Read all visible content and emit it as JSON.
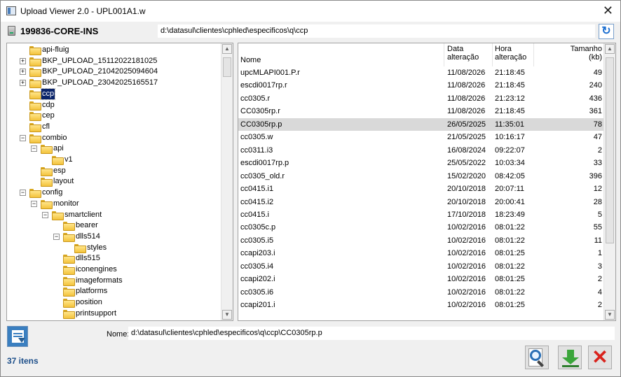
{
  "window": {
    "title": "Upload Viewer 2.0 - UPL001A1.w",
    "close_glyph": "✕"
  },
  "toolbar": {
    "host": "199836-CORE-INS",
    "path": "d:\\datasul\\clientes\\cphled\\especificos\\q\\ccp",
    "refresh_glyph": "↻"
  },
  "tree": {
    "items": [
      {
        "label": "api-fluig",
        "level": 1,
        "expander": "",
        "selected": false
      },
      {
        "label": "BKP_UPLOAD_15112022181025",
        "level": 1,
        "expander": "+",
        "selected": false
      },
      {
        "label": "BKP_UPLOAD_21042025094604",
        "level": 1,
        "expander": "+",
        "selected": false
      },
      {
        "label": "BKP_UPLOAD_23042025165517",
        "level": 1,
        "expander": "+",
        "selected": false
      },
      {
        "label": "ccp",
        "level": 1,
        "expander": "",
        "selected": true
      },
      {
        "label": "cdp",
        "level": 1,
        "expander": "",
        "selected": false
      },
      {
        "label": "cep",
        "level": 1,
        "expander": "",
        "selected": false
      },
      {
        "label": "cfl",
        "level": 1,
        "expander": "",
        "selected": false
      },
      {
        "label": "combio",
        "level": 1,
        "expander": "-",
        "selected": false
      },
      {
        "label": "api",
        "level": 2,
        "expander": "-",
        "selected": false
      },
      {
        "label": "v1",
        "level": 3,
        "expander": "",
        "selected": false
      },
      {
        "label": "esp",
        "level": 2,
        "expander": "",
        "selected": false
      },
      {
        "label": "layout",
        "level": 2,
        "expander": "",
        "selected": false
      },
      {
        "label": "config",
        "level": 1,
        "expander": "-",
        "selected": false
      },
      {
        "label": "monitor",
        "level": 2,
        "expander": "-",
        "selected": false
      },
      {
        "label": "smartclient",
        "level": 3,
        "expander": "-",
        "selected": false
      },
      {
        "label": "bearer",
        "level": 4,
        "expander": "",
        "selected": false
      },
      {
        "label": "dlls514",
        "level": 4,
        "expander": "-",
        "selected": false
      },
      {
        "label": "styles",
        "level": 5,
        "expander": "",
        "selected": false
      },
      {
        "label": "dlls515",
        "level": 4,
        "expander": "",
        "selected": false
      },
      {
        "label": "iconengines",
        "level": 4,
        "expander": "",
        "selected": false
      },
      {
        "label": "imageformats",
        "level": 4,
        "expander": "",
        "selected": false
      },
      {
        "label": "platforms",
        "level": 4,
        "expander": "",
        "selected": false
      },
      {
        "label": "position",
        "level": 4,
        "expander": "",
        "selected": false
      },
      {
        "label": "printsupport",
        "level": 4,
        "expander": "",
        "selected": false
      }
    ]
  },
  "files": {
    "headers": {
      "name": "Nome",
      "date_1": "Data",
      "date_2": "alteração",
      "time_1": "Hora",
      "time_2": "alteração",
      "size_1": "Tamanho",
      "size_2": "(kb)"
    },
    "rows": [
      {
        "name": "upcMLAPI001.P.r",
        "date": "11/08/2026",
        "time": "21:18:45",
        "size": "49",
        "selected": false
      },
      {
        "name": "escdi0017rp.r",
        "date": "11/08/2026",
        "time": "21:18:45",
        "size": "240",
        "selected": false
      },
      {
        "name": "cc0305.r",
        "date": "11/08/2026",
        "time": "21:23:12",
        "size": "436",
        "selected": false
      },
      {
        "name": "CC0305rp.r",
        "date": "11/08/2026",
        "time": "21:18:45",
        "size": "361",
        "selected": false
      },
      {
        "name": "CC0305rp.p",
        "date": "26/05/2025",
        "time": "11:35:01",
        "size": "78",
        "selected": true
      },
      {
        "name": "cc0305.w",
        "date": "21/05/2025",
        "time": "10:16:17",
        "size": "47",
        "selected": false
      },
      {
        "name": "cc0311.i3",
        "date": "16/08/2024",
        "time": "09:22:07",
        "size": "2",
        "selected": false
      },
      {
        "name": "escdi0017rp.p",
        "date": "25/05/2022",
        "time": "10:03:34",
        "size": "33",
        "selected": false
      },
      {
        "name": "cc0305_old.r",
        "date": "15/02/2020",
        "time": "08:42:05",
        "size": "396",
        "selected": false
      },
      {
        "name": "cc0415.i1",
        "date": "20/10/2018",
        "time": "20:07:11",
        "size": "12",
        "selected": false
      },
      {
        "name": "cc0415.i2",
        "date": "20/10/2018",
        "time": "20:00:41",
        "size": "28",
        "selected": false
      },
      {
        "name": "cc0415.i",
        "date": "17/10/2018",
        "time": "18:23:49",
        "size": "5",
        "selected": false
      },
      {
        "name": "cc0305c.p",
        "date": "10/02/2016",
        "time": "08:01:22",
        "size": "55",
        "selected": false
      },
      {
        "name": "cc0305.i5",
        "date": "10/02/2016",
        "time": "08:01:22",
        "size": "11",
        "selected": false
      },
      {
        "name": "ccapi203.i",
        "date": "10/02/2016",
        "time": "08:01:25",
        "size": "1",
        "selected": false
      },
      {
        "name": "cc0305.i4",
        "date": "10/02/2016",
        "time": "08:01:22",
        "size": "3",
        "selected": false
      },
      {
        "name": "ccapi202.i",
        "date": "10/02/2016",
        "time": "08:01:25",
        "size": "2",
        "selected": false
      },
      {
        "name": "cc0305.i6",
        "date": "10/02/2016",
        "time": "08:01:22",
        "size": "4",
        "selected": false
      },
      {
        "name": "ccapi201.i",
        "date": "10/02/2016",
        "time": "08:01:25",
        "size": "2",
        "selected": false
      }
    ]
  },
  "footer": {
    "name_label": "Nome:",
    "name_value": "d:\\datasul\\clientes\\cphled\\especificos\\q\\ccp\\CC0305rp.p",
    "count": "37 itens",
    "close_glyph": "✕"
  },
  "scroll_glyphs": {
    "up": "▲",
    "down": "▼"
  }
}
